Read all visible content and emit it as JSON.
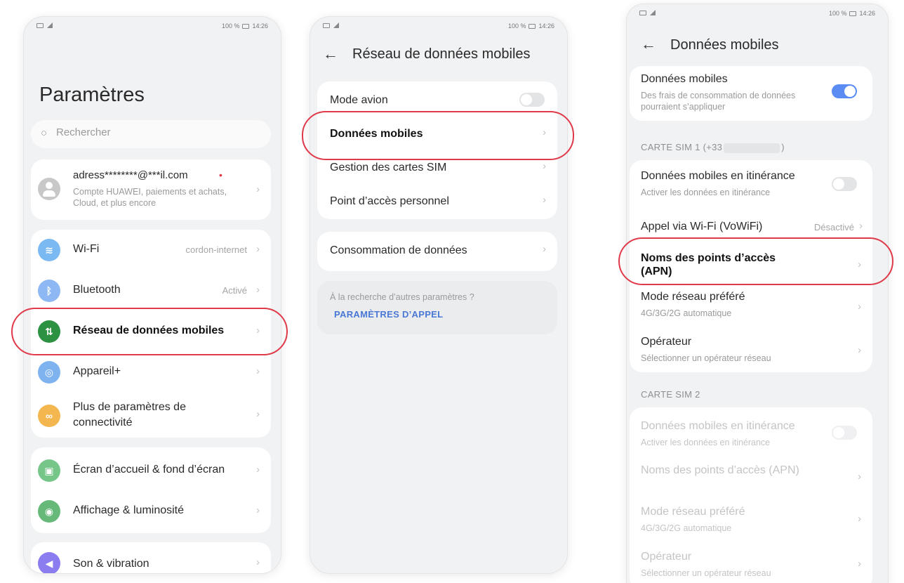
{
  "status_bar": {
    "left_text": "⊿ ",
    "right_text": "100 %",
    "time": "14:26"
  },
  "screen1": {
    "title": "Paramètres",
    "search_placeholder": "Rechercher",
    "account": {
      "email": "adress********@***il.com",
      "description": "Compte HUAWEI, paiements et achats, Cloud, et plus encore"
    },
    "items": [
      {
        "label": "Wi-Fi",
        "value": "cordon-internet",
        "icon": "wifi-icon",
        "color": "#7bb9f2"
      },
      {
        "label": "Bluetooth",
        "value": "Activé",
        "icon": "bluetooth-icon",
        "color": "#8db8f3"
      },
      {
        "label": "Réseau de données mobiles",
        "value": "",
        "icon": "mobile-data-icon",
        "color": "#2d9142"
      },
      {
        "label": "Appareil+",
        "value": "",
        "icon": "device-plus-icon",
        "color": "#7fb3f0"
      },
      {
        "label": "Plus de paramètres de connectivité",
        "value": "",
        "icon": "link-icon",
        "color": "#f4b64e"
      },
      {
        "label": "Écran d’accueil & fond d’écran",
        "value": "",
        "icon": "home-screen-icon",
        "color": "#76c68a"
      },
      {
        "label": "Affichage & luminosité",
        "value": "",
        "icon": "eye-icon",
        "color": "#67b97a"
      },
      {
        "label": "Son & vibration",
        "value": "",
        "icon": "sound-icon",
        "color": "#8b7cf0"
      }
    ]
  },
  "screen2": {
    "title": "Réseau de données mobiles",
    "items": [
      {
        "label": "Mode avion"
      },
      {
        "label": "Données mobiles"
      },
      {
        "label": "Gestion des cartes SIM"
      },
      {
        "label": "Point d’accès personnel"
      },
      {
        "label": "Consommation de données"
      }
    ],
    "hint": "À la recherche d’autres paramètres ?",
    "link": "PARAMÈTRES D’APPEL"
  },
  "screen3": {
    "title": "Données mobiles",
    "mobile_data": {
      "label": "Données mobiles",
      "description": "Des frais de consommation de données pourraient s’appliquer"
    },
    "sim1_title": "CARTE SIM 1 (+33",
    "sim1_title_end": ")",
    "sim1": [
      {
        "label": "Données mobiles en itinérance",
        "description": "Activer les données en itinérance"
      },
      {
        "label": "Appel via Wi-Fi (VoWiFi)",
        "value": "Désactivé"
      },
      {
        "label": "Noms des points d’accès (APN)"
      },
      {
        "label": "Mode réseau préféré",
        "description": "4G/3G/2G automatique"
      },
      {
        "label": "Opérateur",
        "description": "Sélectionner un opérateur réseau"
      }
    ],
    "sim2_title": "CARTE SIM 2",
    "sim2": [
      {
        "label": "Données mobiles en itinérance",
        "description": "Activer les données en itinérance"
      },
      {
        "label": "Noms des points d’accès (APN)"
      },
      {
        "label": "Mode réseau préféré",
        "description": "4G/3G/2G automatique"
      },
      {
        "label": "Opérateur",
        "description": "Sélectionner un opérateur réseau"
      }
    ]
  },
  "colors": {
    "highlight": "#e0394a",
    "toggle_on": "#5b8cf3",
    "link": "#4a78d6"
  }
}
